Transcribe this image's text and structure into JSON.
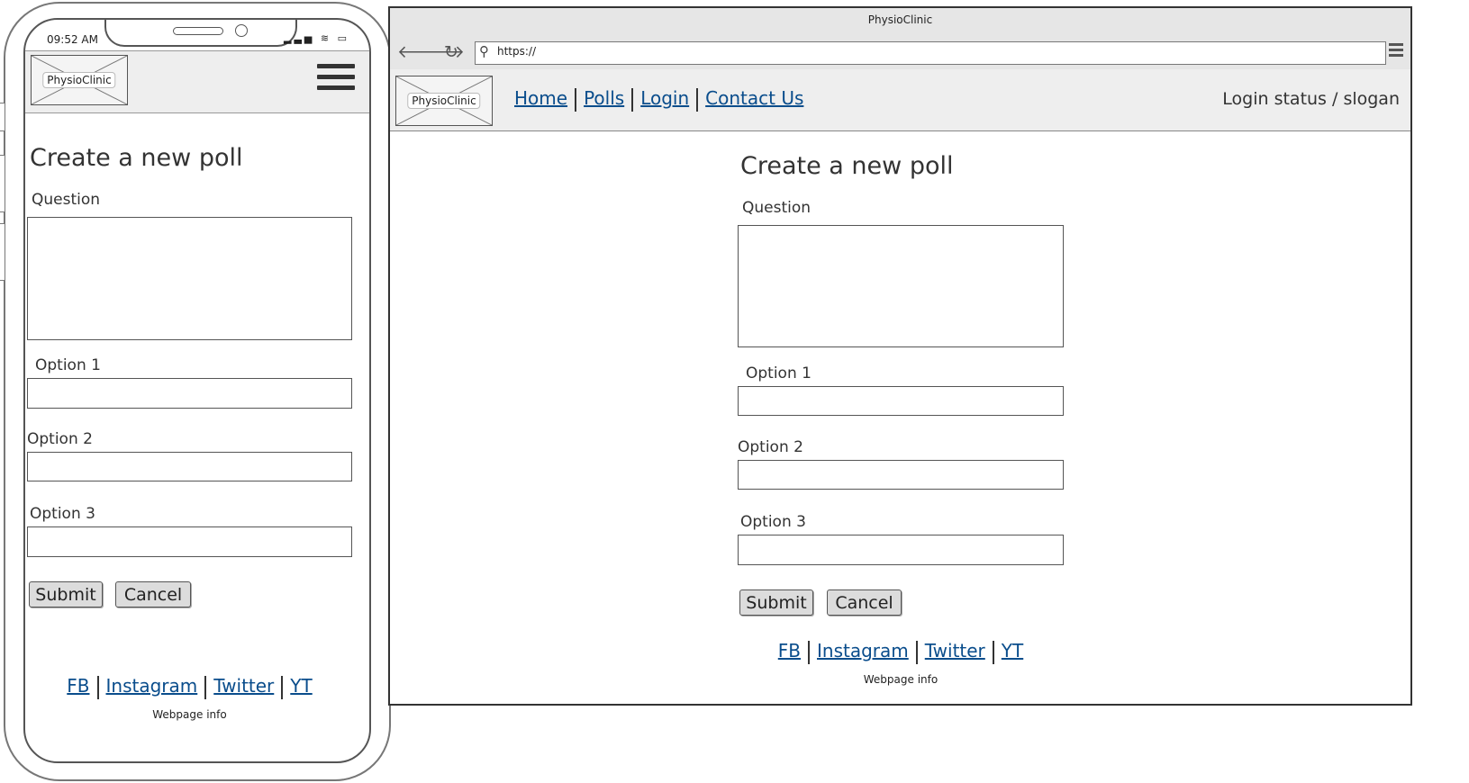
{
  "phone": {
    "time": "09:52 AM",
    "status_icons": "▂▃▅ ≋ ▭",
    "logo": "PhysioClinic",
    "menu_icon": "hamburger-icon"
  },
  "browser": {
    "window_title": "PhysioClinic",
    "url": "https://",
    "back_icon": "🡐",
    "forward_icon": "🡒",
    "reload_icon": "↻",
    "search_icon": "⚲",
    "logo": "PhysioClinic",
    "nav": [
      "Home",
      "Polls",
      "Login",
      "Contact Us"
    ],
    "slogan": "Login status / slogan"
  },
  "form": {
    "title": "Create a new poll",
    "question_label": "Question",
    "option1_label": "Option 1",
    "option2_label": "Option 2",
    "option3_label": "Option 3",
    "submit_label": "Submit",
    "cancel_label": "Cancel"
  },
  "footer": {
    "links": [
      "FB",
      "Instagram",
      "Twitter",
      "YT"
    ],
    "info": "Webpage info"
  }
}
